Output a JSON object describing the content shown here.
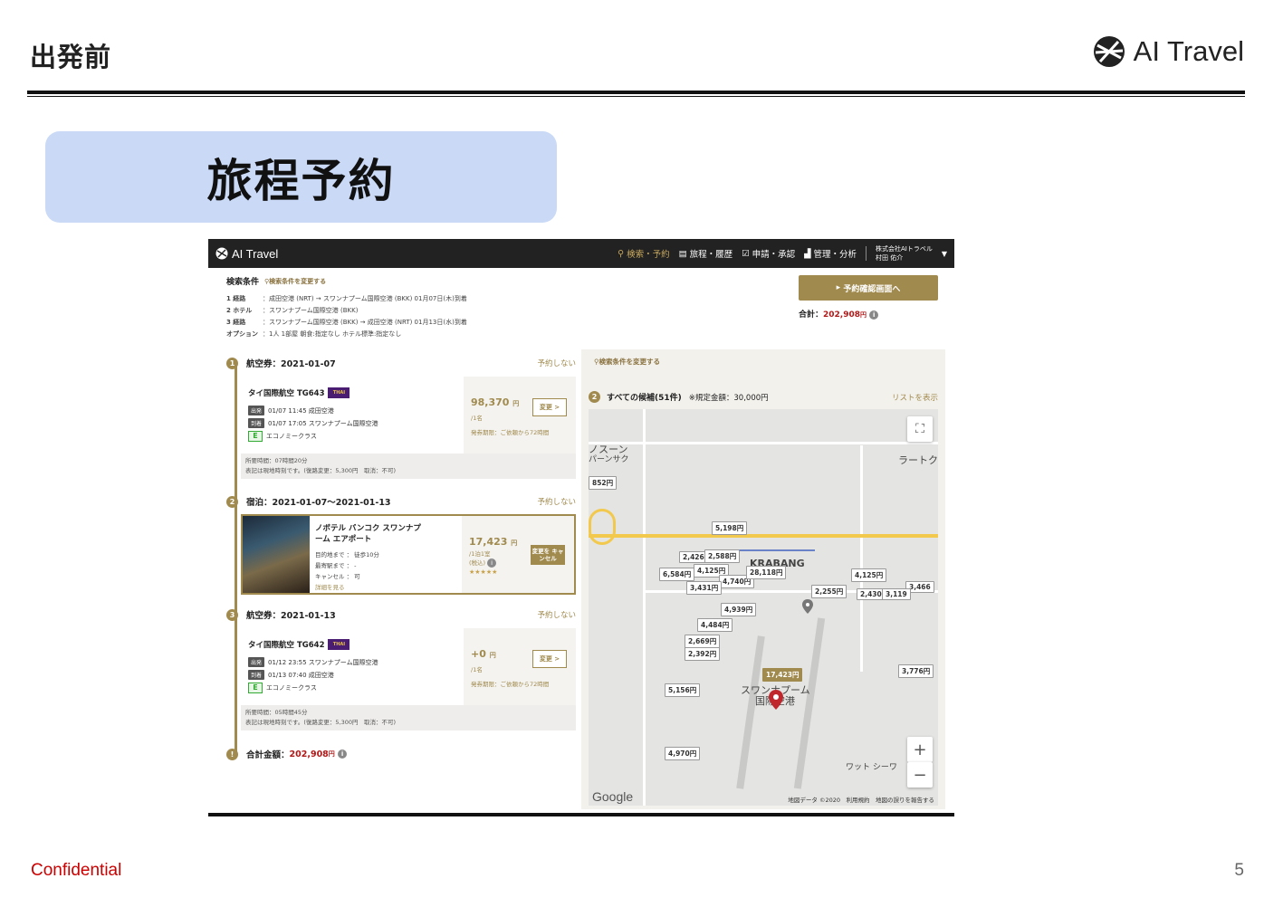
{
  "slide": {
    "title": "出発前",
    "brand": "AI Travel",
    "banner": "旅程予約",
    "confidential": "Confidential",
    "page": "5"
  },
  "app": {
    "logo": "AI Travel",
    "nav": [
      "検索・予約",
      "旅程・履歴",
      "申請・承認",
      "管理・分析"
    ],
    "user_company": "株式会社AIトラベル",
    "user_name": "村田 佑介"
  },
  "conditions": {
    "title": "検索条件",
    "change_link": "検索条件を変更する",
    "rows": [
      {
        "key": "1 経路",
        "value": "：成田空港 (NRT) → スワンナプーム国際空港 (BKK) 01月07日(木)到着"
      },
      {
        "key": "2 ホテル",
        "value": "：スワンナプーム国際空港 (BKK)"
      },
      {
        "key": "3 経路",
        "value": "：スワンナプーム国際空港 (BKK) → 成田空港 (NRT) 01月13日(水)到着"
      },
      {
        "key": "オプション",
        "value": "：1人 1部屋 朝食:指定なし ホテル標準:指定なし"
      }
    ]
  },
  "confirm_button": "予約確認画面へ",
  "total": {
    "label": "合計：",
    "value": "202,908",
    "unit": "円"
  },
  "steps": [
    {
      "num": "1",
      "title": "航空券：2021-01-07",
      "skip": "予約しない"
    },
    {
      "num": "2",
      "title": "宿泊：2021-01-07〜2021-01-13",
      "skip": "予約しない"
    },
    {
      "num": "3",
      "title": "航空券：2021-01-13",
      "skip": "予約しない"
    }
  ],
  "flight1": {
    "airline": "タイ国際航空 TG643",
    "dep_tag": "出発",
    "dep": "01/07 11:45 成田空港",
    "arr_tag": "到着",
    "arr": "01/07 17:05 スワンナプーム国際空港",
    "class_code": "E",
    "class": "エコノミークラス",
    "price": "98,370",
    "unit": "円",
    "per": "/1名",
    "deadline": "発券期限：ご依頼から72時間",
    "change": "変更 >",
    "note1": "所要時間：07時間20分",
    "note2": "表記は現地時刻です。(復路変更：5,300円　取消：不可)"
  },
  "hotel": {
    "name": "ノボテル バンコク スワンナプーム エアポート",
    "info1": "目的地まで ： 徒歩10分",
    "info2": "最寄駅まで ： -",
    "info3": "キャンセル ： 可",
    "details": "詳細を見る",
    "price": "17,423",
    "unit": "円",
    "per": "/1泊1室",
    "tax": "(税込)",
    "stars": "★★★★★",
    "cancel": "変更を キャンセル"
  },
  "flight2": {
    "airline": "タイ国際航空 TG642",
    "dep_tag": "出発",
    "dep": "01/12 23:55 スワンナプーム国際空港",
    "arr_tag": "到着",
    "arr": "01/13 07:40 成田空港",
    "class_code": "E",
    "class": "エコノミークラス",
    "price": "+0",
    "unit": "円",
    "per": "/1名",
    "deadline": "発券期限：ご依頼から72時間",
    "change": "変更 >",
    "note1": "所要時間：05時間45分",
    "note2": "表記は現地時刻です。(復路変更：5,300円　取消：不可)"
  },
  "grand_total": {
    "label": "合計金額：",
    "value": "202,908",
    "unit": "円"
  },
  "map_panel": {
    "change_link": "検索条件を変更する",
    "num": "2",
    "count": "すべての候補(51件)",
    "standard": "※規定金額：30,000円",
    "list_link": "リストを表示",
    "labels": [
      "ノスーン",
      "パーンサク",
      "ラートク",
      "KRABANG",
      "スワンナプーム",
      "国際空港",
      "ワット シーワ",
      "Google"
    ],
    "pins": [
      "852円",
      "5,198円",
      "2,426",
      "2,588円",
      "4,125円",
      "6,584円",
      "4,740円",
      "28,118円",
      "3,431円",
      "4,939円",
      "4,484円",
      "2,669円",
      "2,392円",
      "5,156円",
      "17,423円",
      "4,970円",
      "2,255円",
      "4,125円",
      "3,466",
      "2,430",
      "3,119",
      "3,776円"
    ],
    "footer": "地図データ ©2020　利用規約　地図の誤りを報告する"
  }
}
